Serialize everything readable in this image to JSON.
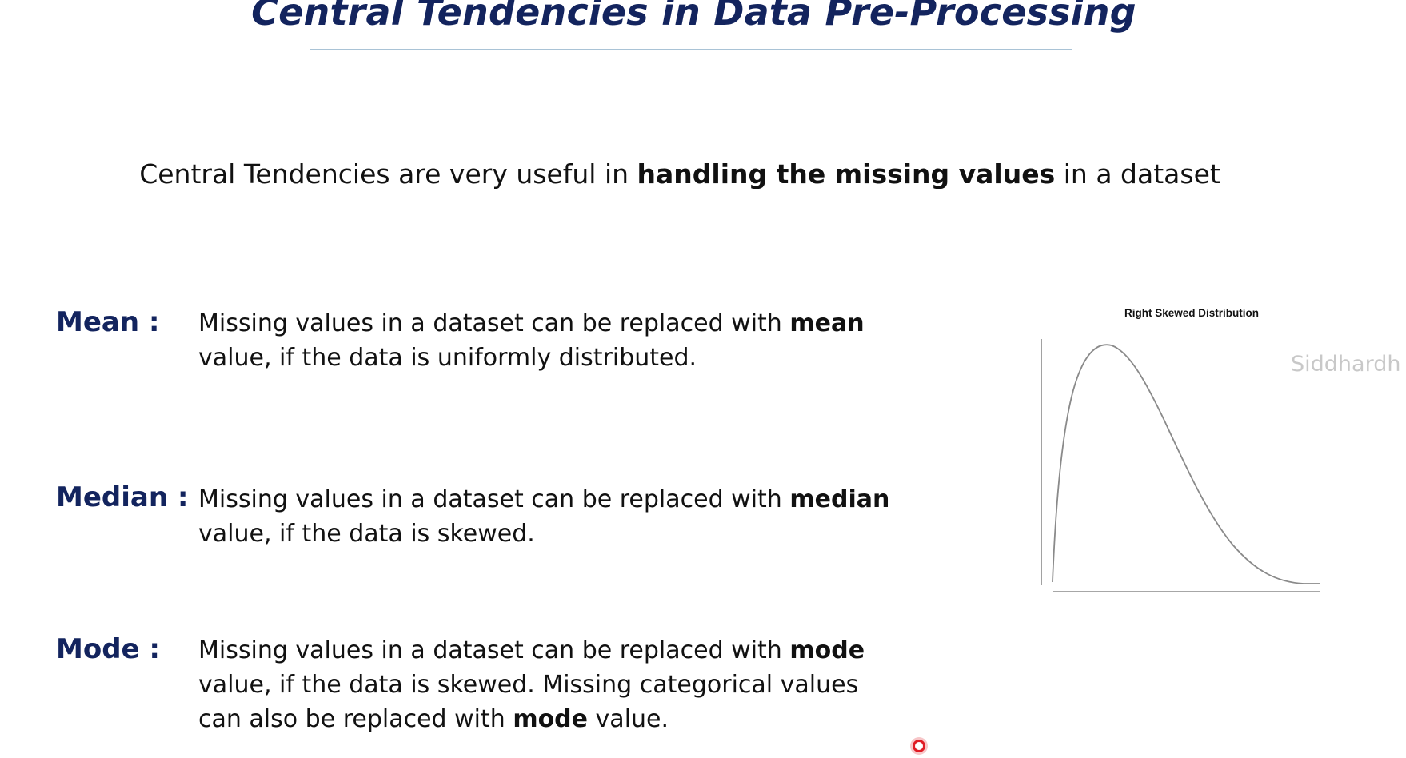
{
  "slide": {
    "title": "Central Tendencies in Data Pre-Processing",
    "intro": {
      "before": "Central Tendencies are very useful in ",
      "bold": "handling the missing values",
      "after": " in a dataset"
    }
  },
  "items": [
    {
      "term": "Mean :",
      "desc_before": "Missing values in a dataset can be replaced with ",
      "desc_bold": "mean",
      "desc_after": " value, if the data is uniformly distributed."
    },
    {
      "term": "Median :",
      "desc_before": "Missing values in a dataset can be replaced with ",
      "desc_bold": "median",
      "desc_after": " value, if the data is skewed."
    },
    {
      "term": "Mode :",
      "desc_before": "Missing values in a dataset can be replaced with ",
      "desc_bold": "mode",
      "desc_after": " value, if the data is skewed. Missing categorical values can also be replaced with ",
      "desc_bold2": "mode",
      "desc_after2": " value."
    }
  ],
  "chart_data": {
    "type": "line",
    "title": "Right Skewed Distribution",
    "grid": false,
    "axes_labels": false,
    "shape": "right-skewed density curve with peak near the left and long tail to the right"
  },
  "watermark": "Siddhardh",
  "colors": {
    "title": "#13245e",
    "terms": "#13245e",
    "title_rule": "#a9c3d6",
    "curve": "#8a8a8a",
    "axis": "#8a8a8a",
    "watermark": "#c8c8c8",
    "cursor": "#e01b24"
  }
}
